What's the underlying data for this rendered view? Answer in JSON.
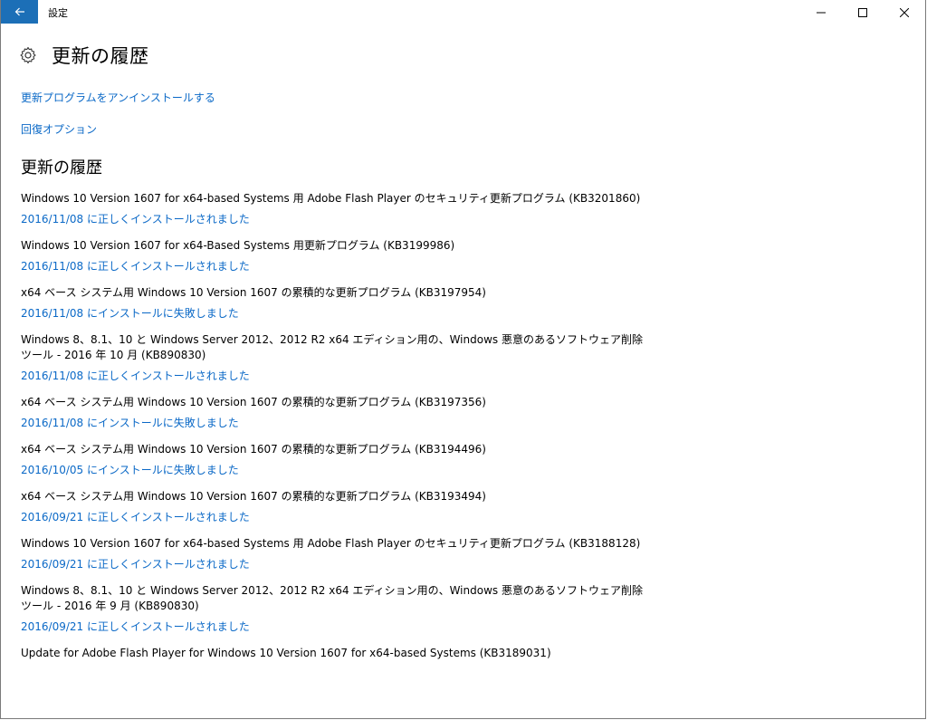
{
  "window": {
    "title": "設定",
    "accent": "#1c6fb7",
    "link_color": "#0b69c7"
  },
  "header": {
    "title": "更新の履歴",
    "icon": "gear-icon"
  },
  "links": {
    "uninstall": "更新プログラムをアンインストールする",
    "recovery": "回復オプション"
  },
  "section": {
    "title": "更新の履歴"
  },
  "history": [
    {
      "name": "Windows 10 Version 1607 for x64-based Systems 用 Adobe Flash Player のセキュリティ更新プログラム (KB3201860)",
      "status": "2016/11/08 に正しくインストールされました"
    },
    {
      "name": "Windows 10 Version 1607 for x64-Based Systems 用更新プログラム (KB3199986)",
      "status": "2016/11/08 に正しくインストールされました"
    },
    {
      "name": "x64 ベース システム用 Windows 10 Version 1607 の累積的な更新プログラム (KB3197954)",
      "status": "2016/11/08 にインストールに失敗しました"
    },
    {
      "name": "Windows 8、8.1、10 と Windows Server 2012、2012 R2 x64 エディション用の、Windows 悪意のあるソフトウェア削除ツール - 2016 年 10 月 (KB890830)",
      "status": "2016/11/08 に正しくインストールされました"
    },
    {
      "name": "x64 ベース システム用 Windows 10 Version 1607 の累積的な更新プログラム (KB3197356)",
      "status": "2016/11/08 にインストールに失敗しました"
    },
    {
      "name": "x64 ベース システム用 Windows 10 Version 1607 の累積的な更新プログラム (KB3194496)",
      "status": "2016/10/05 にインストールに失敗しました"
    },
    {
      "name": "x64 ベース システム用 Windows 10 Version 1607 の累積的な更新プログラム (KB3193494)",
      "status": "2016/09/21 に正しくインストールされました"
    },
    {
      "name": "Windows 10 Version 1607 for x64-based Systems 用 Adobe Flash Player のセキュリティ更新プログラム (KB3188128)",
      "status": "2016/09/21 に正しくインストールされました"
    },
    {
      "name": "Windows 8、8.1、10 と Windows Server 2012、2012 R2 x64 エディション用の、Windows 悪意のあるソフトウェア削除ツール - 2016 年 9 月 (KB890830)",
      "status": "2016/09/21 に正しくインストールされました"
    },
    {
      "name": "Update for Adobe Flash Player for Windows 10 Version 1607 for x64-based Systems (KB3189031)",
      "status": ""
    }
  ]
}
